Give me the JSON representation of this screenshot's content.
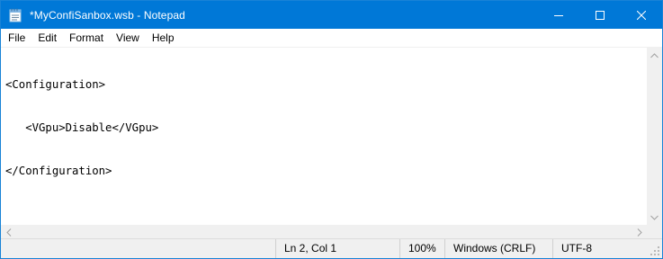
{
  "window": {
    "title": "*MyConfiSanbox.wsb - Notepad",
    "accent_color": "#0078d7"
  },
  "icons": {
    "app": "notepad-icon",
    "minimize": "minimize-icon",
    "maximize": "maximize-icon",
    "close": "close-icon"
  },
  "menu": {
    "items": [
      {
        "label": "File"
      },
      {
        "label": "Edit"
      },
      {
        "label": "Format"
      },
      {
        "label": "View"
      },
      {
        "label": "Help"
      }
    ]
  },
  "editor": {
    "lines": [
      "<Configuration>",
      "   <VGpu>Disable</VGpu>",
      "</Configuration>"
    ]
  },
  "status": {
    "position": "Ln 2, Col 1",
    "zoom": "100%",
    "line_endings": "Windows (CRLF)",
    "encoding": "UTF-8"
  }
}
